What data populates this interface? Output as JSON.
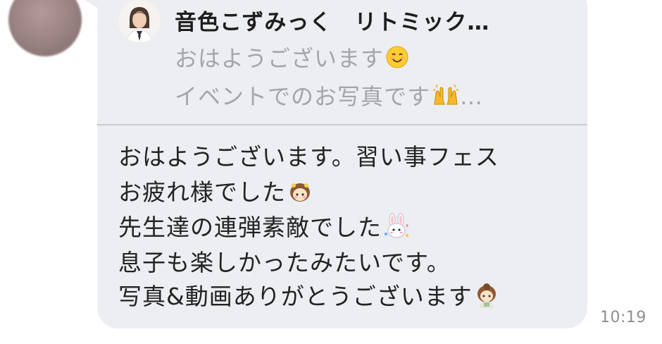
{
  "message": {
    "quote": {
      "name": "音色こずみっく　リトミック…",
      "line1": "おはようございます",
      "line2": "イベントでのお写真です",
      "line2_suffix": "…"
    },
    "body": [
      "おはようございます。習い事フェス",
      "お疲れ様でした",
      "先生達の連弾素敵でした",
      "息子も楽しかったみたいです。",
      "写真&動画ありがとうございます"
    ],
    "time": "10:19"
  },
  "icons": {
    "sender_avatar": "blurred-avatar",
    "quote_avatar": "person-photo-avatar",
    "smile_emoji": "smiling-face-emoji",
    "raised_hands_emoji": "raised-hands-emoji",
    "girl_emoji": "girl-sticker-emoji",
    "bunny_emoji": "bunny-sticker-emoji"
  },
  "colors": {
    "bubble": "#eceef2",
    "quote_text": "#a4a5a9",
    "body_text": "#232325",
    "timestamp": "#8e8f94"
  }
}
